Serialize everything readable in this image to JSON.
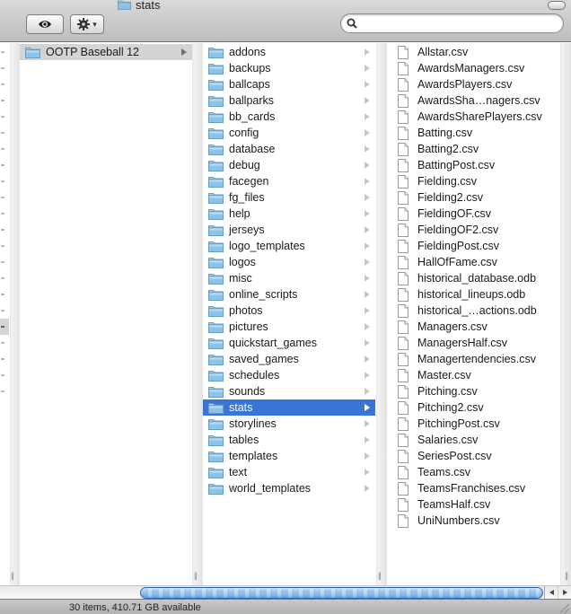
{
  "window": {
    "title": "stats",
    "title_icon": "folder-icon"
  },
  "toolbar": {
    "quicklook_icon": "eye-icon",
    "action_icon": "gear-icon",
    "action_menu_indicator": "▾",
    "search": {
      "value": "",
      "placeholder": "",
      "icon": "search-icon"
    }
  },
  "columns": [
    {
      "name": "parent-column",
      "items": [
        {
          "label": "OOTP Baseball 12",
          "type": "folder",
          "state": "inactive-selected"
        }
      ]
    },
    {
      "name": "ootp-baseball-12-column",
      "items": [
        {
          "label": "addons",
          "type": "folder"
        },
        {
          "label": "backups",
          "type": "folder"
        },
        {
          "label": "ballcaps",
          "type": "folder"
        },
        {
          "label": "ballparks",
          "type": "folder"
        },
        {
          "label": "bb_cards",
          "type": "folder"
        },
        {
          "label": "config",
          "type": "folder"
        },
        {
          "label": "database",
          "type": "folder"
        },
        {
          "label": "debug",
          "type": "folder"
        },
        {
          "label": "facegen",
          "type": "folder"
        },
        {
          "label": "fg_files",
          "type": "folder"
        },
        {
          "label": "help",
          "type": "folder"
        },
        {
          "label": "jerseys",
          "type": "folder"
        },
        {
          "label": "logo_templates",
          "type": "folder"
        },
        {
          "label": "logos",
          "type": "folder"
        },
        {
          "label": "misc",
          "type": "folder"
        },
        {
          "label": "online_scripts",
          "type": "folder"
        },
        {
          "label": "photos",
          "type": "folder"
        },
        {
          "label": "pictures",
          "type": "folder"
        },
        {
          "label": "quickstart_games",
          "type": "folder"
        },
        {
          "label": "saved_games",
          "type": "folder"
        },
        {
          "label": "schedules",
          "type": "folder"
        },
        {
          "label": "sounds",
          "type": "folder"
        },
        {
          "label": "stats",
          "type": "folder",
          "state": "selected"
        },
        {
          "label": "storylines",
          "type": "folder"
        },
        {
          "label": "tables",
          "type": "folder"
        },
        {
          "label": "templates",
          "type": "folder"
        },
        {
          "label": "text",
          "type": "folder"
        },
        {
          "label": "world_templates",
          "type": "folder"
        }
      ]
    },
    {
      "name": "stats-column",
      "items": [
        {
          "label": "Allstar.csv",
          "type": "file"
        },
        {
          "label": "AwardsManagers.csv",
          "type": "file"
        },
        {
          "label": "AwardsPlayers.csv",
          "type": "file"
        },
        {
          "label": "AwardsSha…nagers.csv",
          "type": "file"
        },
        {
          "label": "AwardsSharePlayers.csv",
          "type": "file"
        },
        {
          "label": "Batting.csv",
          "type": "file"
        },
        {
          "label": "Batting2.csv",
          "type": "file"
        },
        {
          "label": "BattingPost.csv",
          "type": "file"
        },
        {
          "label": "Fielding.csv",
          "type": "file"
        },
        {
          "label": "Fielding2.csv",
          "type": "file"
        },
        {
          "label": "FieldingOF.csv",
          "type": "file"
        },
        {
          "label": "FieldingOF2.csv",
          "type": "file"
        },
        {
          "label": "FieldingPost.csv",
          "type": "file"
        },
        {
          "label": "HallOfFame.csv",
          "type": "file"
        },
        {
          "label": "historical_database.odb",
          "type": "file"
        },
        {
          "label": "historical_lineups.odb",
          "type": "file"
        },
        {
          "label": "historical_…actions.odb",
          "type": "file"
        },
        {
          "label": "Managers.csv",
          "type": "file"
        },
        {
          "label": "ManagersHalf.csv",
          "type": "file"
        },
        {
          "label": "Managertendencies.csv",
          "type": "file"
        },
        {
          "label": "Master.csv",
          "type": "file"
        },
        {
          "label": "Pitching.csv",
          "type": "file"
        },
        {
          "label": "Pitching2.csv",
          "type": "file"
        },
        {
          "label": "PitchingPost.csv",
          "type": "file"
        },
        {
          "label": "Salaries.csv",
          "type": "file"
        },
        {
          "label": "SeriesPost.csv",
          "type": "file"
        },
        {
          "label": "Teams.csv",
          "type": "file"
        },
        {
          "label": "TeamsFranchises.csv",
          "type": "file"
        },
        {
          "label": "TeamsHalf.csv",
          "type": "file"
        },
        {
          "label": "UniNumbers.csv",
          "type": "file"
        }
      ]
    }
  ],
  "partial_column": {
    "row_count": 22,
    "highlighted_index": 17
  },
  "column_resize_grip": "||",
  "status_bar": {
    "text": "30 items, 410.71 GB available"
  },
  "colors": {
    "selection": "#3875d7",
    "inactive_selection": "#d4d4d4",
    "folder": "#8ec3e8",
    "scroll_thumb": "#8fc0ee"
  }
}
